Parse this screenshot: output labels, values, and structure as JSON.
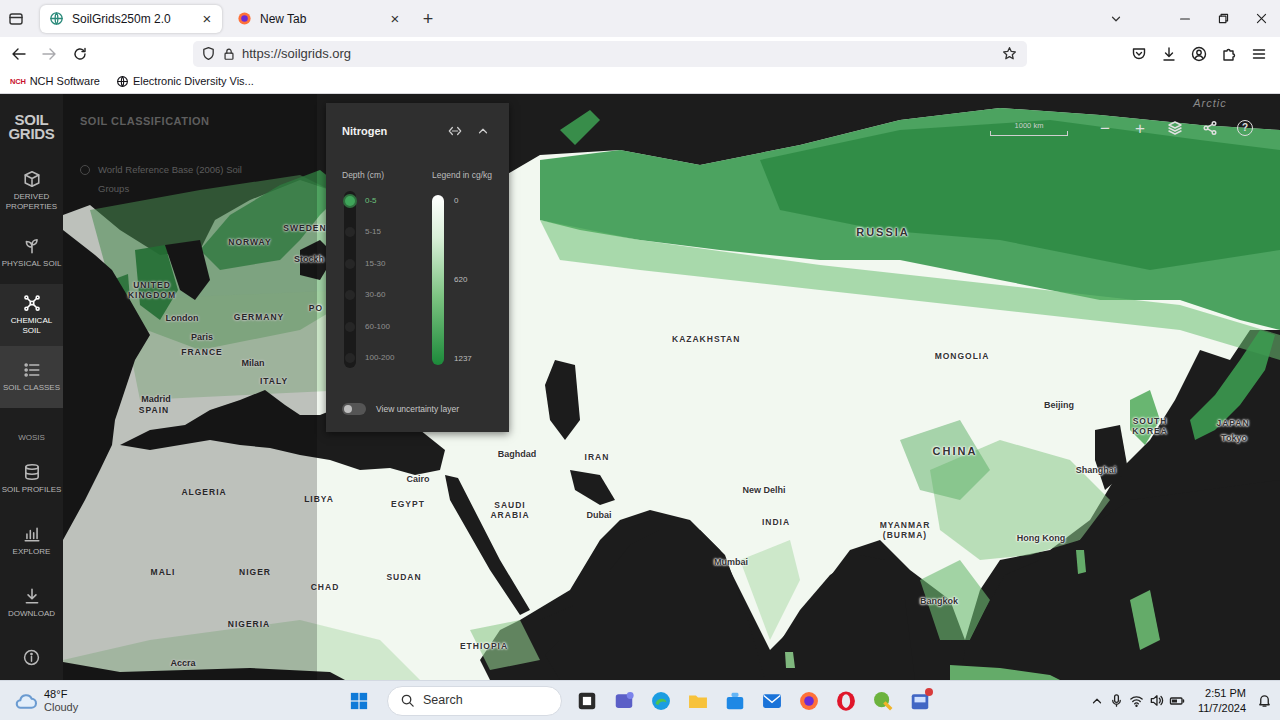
{
  "browser": {
    "tabs": [
      {
        "label": "SoilGrids250m 2.0",
        "close": "×",
        "selected": true
      },
      {
        "label": "New Tab",
        "close": "×",
        "selected": false
      }
    ],
    "new_tab": "+",
    "url": "https://soilgrids.org",
    "bookmarks": [
      {
        "icon_text": "NCH",
        "label": "NCH Software"
      },
      {
        "label": "Electronic Diversity Vis..."
      }
    ]
  },
  "sidebar": {
    "logo": [
      "SOIL",
      "GRIDS"
    ],
    "items": [
      {
        "kind": "nav",
        "label": "DERIVED PROPERTIES",
        "selected": false,
        "hovered": false
      },
      {
        "kind": "nav",
        "label": "PHYSICAL SOIL",
        "selected": false,
        "hovered": false
      },
      {
        "kind": "nav",
        "label": "CHEMICAL SOIL",
        "selected": true,
        "hovered": false
      },
      {
        "kind": "nav",
        "label": "SOIL CLASSES",
        "selected": false,
        "hovered": true
      },
      {
        "kind": "heading",
        "label": "WOSIS"
      },
      {
        "kind": "nav",
        "label": "SOIL PROFILES",
        "selected": false,
        "hovered": false
      },
      {
        "kind": "nav",
        "label": "EXPLORE",
        "selected": false,
        "hovered": false
      },
      {
        "kind": "nav",
        "label": "DOWNLOAD",
        "selected": false,
        "hovered": false
      },
      {
        "kind": "info"
      }
    ]
  },
  "classification": {
    "title": "SOIL CLASSIFICATION",
    "option": {
      "label": "World Reference Base (2006) Soil Groups",
      "selected": false
    }
  },
  "layer": {
    "title": "Nitrogen",
    "depth_heading": "Depth (cm)",
    "depths": [
      {
        "label": "0-5",
        "selected": true
      },
      {
        "label": "5-15",
        "selected": false
      },
      {
        "label": "15-30",
        "selected": false
      },
      {
        "label": "30-60",
        "selected": false
      },
      {
        "label": "60-100",
        "selected": false
      },
      {
        "label": "100-200",
        "selected": false
      }
    ],
    "legend_heading": "Legend in cg/kg",
    "legend_ticks": [
      "0",
      "620",
      "1237"
    ],
    "uncertainty": {
      "label": "View uncertainty layer",
      "on": false
    }
  },
  "map": {
    "scale": "1000 km",
    "controls": [
      {
        "kind": "text",
        "label": "−"
      },
      {
        "kind": "text",
        "label": "+"
      },
      {
        "kind": "layers"
      },
      {
        "kind": "share"
      },
      {
        "kind": "help",
        "label": "?"
      }
    ],
    "labels": [
      {
        "text": "Arctic",
        "kind": "ocean"
      },
      {
        "text": "SWEDEN",
        "kind": "country"
      },
      {
        "text": "NORWAY",
        "kind": "country"
      },
      {
        "text": "Stockh",
        "kind": "city"
      },
      {
        "text": "UNITED KINGDOM",
        "kind": "country"
      },
      {
        "text": "London",
        "kind": "city"
      },
      {
        "text": "GERMANY",
        "kind": "country"
      },
      {
        "text": "PO",
        "kind": "country"
      },
      {
        "text": "Paris",
        "kind": "city"
      },
      {
        "text": "FRANCE",
        "kind": "country"
      },
      {
        "text": "Milan",
        "kind": "city"
      },
      {
        "text": "ITALY",
        "kind": "country"
      },
      {
        "text": "Madrid",
        "kind": "city"
      },
      {
        "text": "SPAIN",
        "kind": "country"
      },
      {
        "text": "Cairo",
        "kind": "city"
      },
      {
        "text": "LIBYA",
        "kind": "country"
      },
      {
        "text": "EGYPT",
        "kind": "country"
      },
      {
        "text": "ALGERIA",
        "kind": "country"
      },
      {
        "text": "Baghdad",
        "kind": "city"
      },
      {
        "text": "IRAN",
        "kind": "country"
      },
      {
        "text": "SAUDI ARABIA",
        "kind": "country"
      },
      {
        "text": "Dubai",
        "kind": "city"
      },
      {
        "text": "KAZAKHSTAN",
        "kind": "country"
      },
      {
        "text": "RUSSIA",
        "kind": "major"
      },
      {
        "text": "MONGOLIA",
        "kind": "country"
      },
      {
        "text": "Beijing",
        "kind": "city"
      },
      {
        "text": "CHINA",
        "kind": "major"
      },
      {
        "text": "SOUTH KOREA",
        "kind": "country"
      },
      {
        "text": "JAPAN",
        "kind": "country"
      },
      {
        "text": "Tokyo",
        "kind": "city"
      },
      {
        "text": "Shanghai",
        "kind": "city"
      },
      {
        "text": "New Delhi",
        "kind": "city"
      },
      {
        "text": "INDIA",
        "kind": "country"
      },
      {
        "text": "Mumbai",
        "kind": "city"
      },
      {
        "text": "MYANMAR (BURMA)",
        "kind": "country"
      },
      {
        "text": "Hong Kong",
        "kind": "city"
      },
      {
        "text": "Bangkok",
        "kind": "city"
      },
      {
        "text": "MALI",
        "kind": "country"
      },
      {
        "text": "NIGER",
        "kind": "country"
      },
      {
        "text": "CHAD",
        "kind": "country"
      },
      {
        "text": "SUDAN",
        "kind": "country"
      },
      {
        "text": "NIGERIA",
        "kind": "country"
      },
      {
        "text": "ETHIOPIA",
        "kind": "country"
      },
      {
        "text": "Accra",
        "kind": "city"
      }
    ]
  },
  "taskbar": {
    "weather": {
      "temp": "48°F",
      "condition": "Cloudy"
    },
    "search": "Search",
    "time": "2:51 PM",
    "date": "11/7/2024",
    "notification_dot": true
  }
}
